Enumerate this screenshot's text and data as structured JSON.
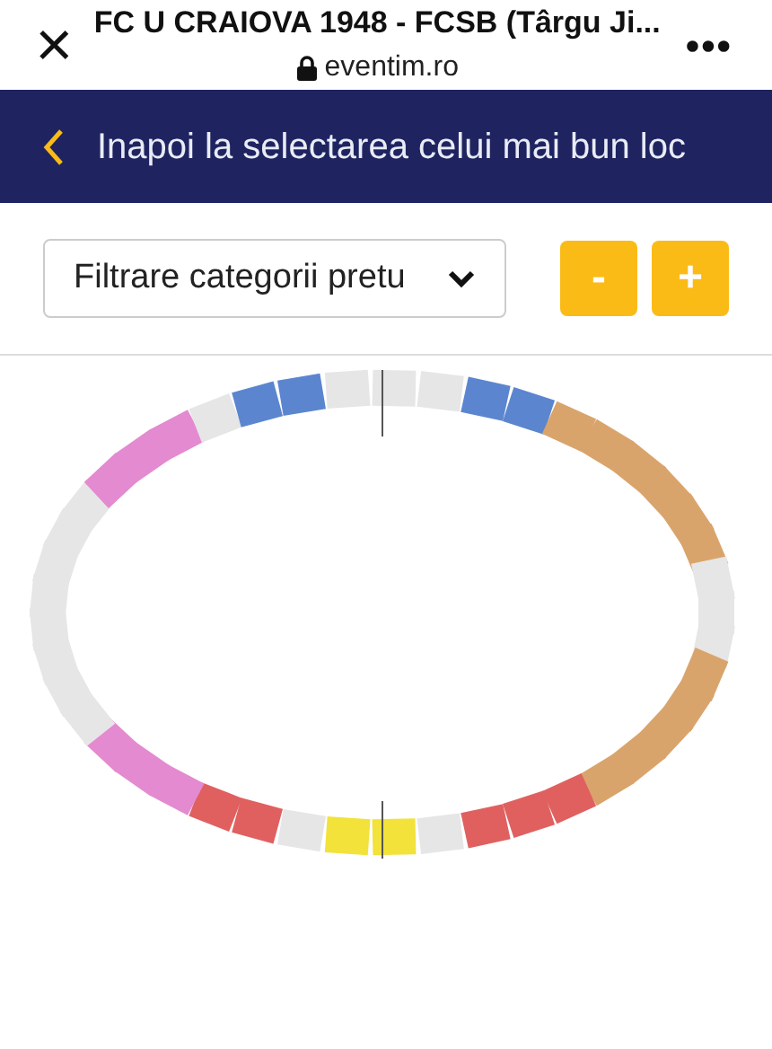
{
  "browser_bar": {
    "close": "×",
    "title": "FC U CRAIOVA 1948 - FCSB (Târgu Ji...",
    "url": "eventim.ro",
    "menu": "•••"
  },
  "back_link": {
    "label": "Inapoi la selectarea celui mai bun loc"
  },
  "filter": {
    "value": "Filtrare categorii pretu"
  },
  "zoom_buttons": [
    "-",
    "+"
  ]
}
